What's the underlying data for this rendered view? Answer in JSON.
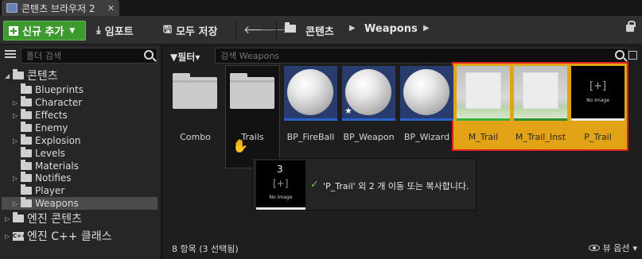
{
  "tab": {
    "title": "콘텐츠 브라우저 2",
    "close": "✕"
  },
  "toolbar": {
    "new_button": "신규 추가",
    "import_button": "임포트",
    "save_all_button": "모두 저장",
    "back_icon": "arrow-left",
    "forward_icon": "arrow-right"
  },
  "breadcrumb": {
    "root": "콘텐츠",
    "current": "Weapons"
  },
  "left_panel": {
    "search_placeholder": "폴더 검색",
    "tree": {
      "content": "콘텐츠",
      "children": [
        "Blueprints",
        "Character",
        "Effects",
        "Enemy",
        "Explosion",
        "Levels",
        "Materials",
        "Notifies",
        "Player",
        "Weapons"
      ],
      "engine_content": "엔진 콘텐츠",
      "engine_cpp": "엔진 C++ 클래스"
    }
  },
  "right_panel": {
    "filter_label": "필터",
    "search_placeholder": "검색 Weapons",
    "assets": [
      {
        "name": "Combo",
        "type": "folder"
      },
      {
        "name": "Trails",
        "type": "folder"
      },
      {
        "name": "BP_FireBall",
        "type": "blueprint"
      },
      {
        "name": "BP_Weapon",
        "type": "blueprint"
      },
      {
        "name": "BP_Wizard",
        "type": "blueprint"
      },
      {
        "name": "M_Trail",
        "type": "material"
      },
      {
        "name": "M_Trail_Inst",
        "type": "material-instance"
      },
      {
        "name": "P_Trail",
        "type": "particle-system"
      }
    ],
    "thumb_placeholder": "[+]",
    "no_image": "No Image",
    "drag_tooltip": {
      "count": "3",
      "check_icon": "✓",
      "message": "'P_Trail' 외 2 개 이동 또는 복사합니다."
    },
    "status": "8 항목 (3 선택됨)",
    "view_options": "뷰 옵션"
  }
}
